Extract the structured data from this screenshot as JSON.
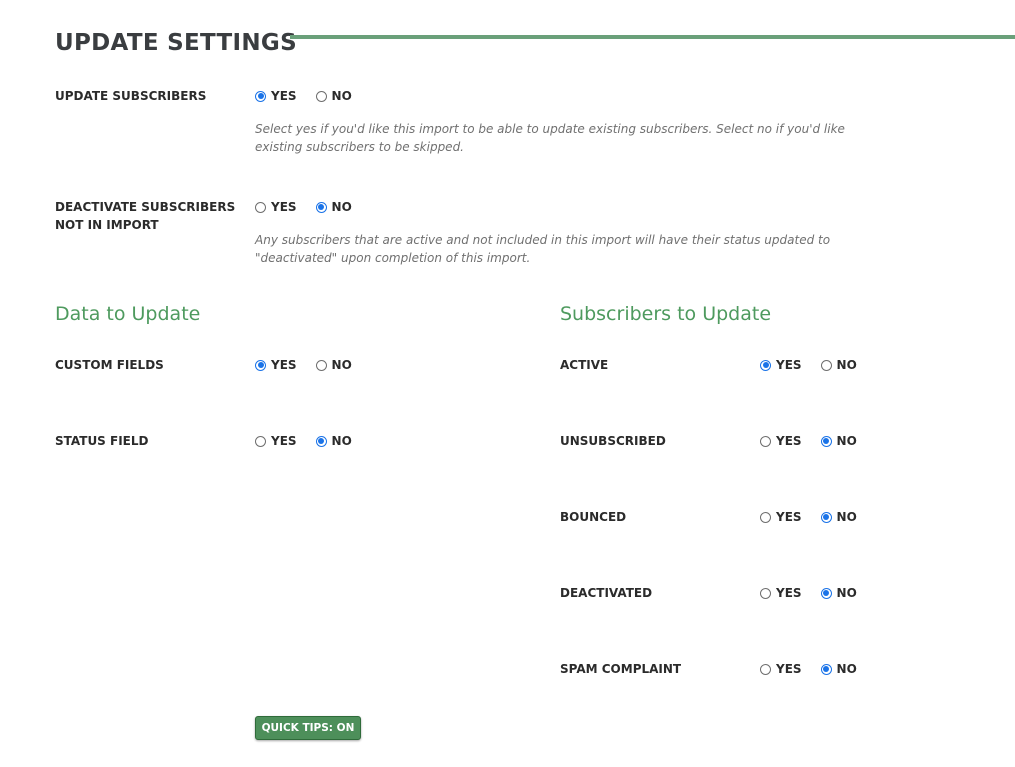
{
  "header": {
    "title": "UPDATE SETTINGS"
  },
  "options": {
    "yes": "YES",
    "no": "NO"
  },
  "update_subscribers": {
    "label": "UPDATE SUBSCRIBERS",
    "selected": "YES",
    "help": "Select yes if you'd like this import to be able to update existing subscribers. Select no if you'd like existing subscribers to be skipped."
  },
  "deactivate": {
    "label": "DEACTIVATE SUBSCRIBERS NOT IN IMPORT",
    "selected": "NO",
    "help": "Any subscribers that are active and not included in this import will have their status updated to \"deactivated\" upon completion of this import."
  },
  "data_to_update": {
    "title": "Data to Update",
    "rows": [
      {
        "label": "CUSTOM FIELDS",
        "selected": "YES"
      },
      {
        "label": "STATUS FIELD",
        "selected": "NO"
      }
    ]
  },
  "subscribers_to_update": {
    "title": "Subscribers to Update",
    "rows": [
      {
        "label": "ACTIVE",
        "selected": "YES"
      },
      {
        "label": "UNSUBSCRIBED",
        "selected": "NO"
      },
      {
        "label": "BOUNCED",
        "selected": "NO"
      },
      {
        "label": "DEACTIVATED",
        "selected": "NO"
      },
      {
        "label": "SPAM COMPLAINT",
        "selected": "NO"
      }
    ]
  },
  "quick_tips_button": "QUICK TIPS: ON",
  "colors": {
    "accent_green": "#4e9a5e",
    "rule_green": "#6aa07a",
    "button_green": "#4d8f5a",
    "radio_blue": "#1a73e8"
  }
}
